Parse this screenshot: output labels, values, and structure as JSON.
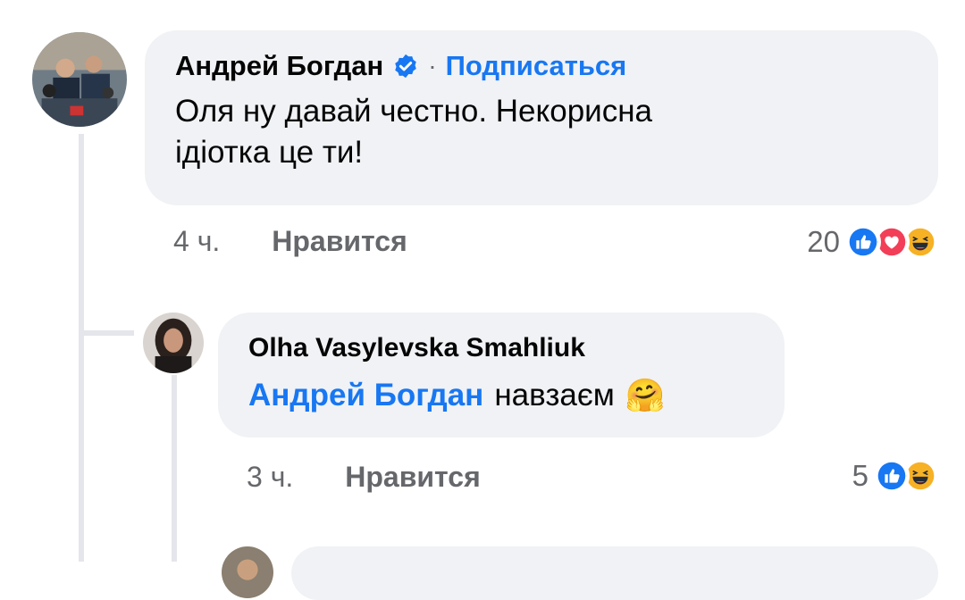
{
  "comment1": {
    "author": "Андрей Богдан",
    "separator": "·",
    "follow_label": "Подписаться",
    "text_line1": "Оля ну давай честно. Некорисна",
    "text_line2": "ідіотка це ти!",
    "time": "4 ч.",
    "like_label": "Нравится",
    "reaction_count": "20",
    "reactions": [
      "like-icon",
      "love-icon",
      "haha-icon"
    ]
  },
  "reply1": {
    "author": "Olha Vasylevska Smahliuk",
    "mention": "Андрей Богдан",
    "text": "навзаєм",
    "emoji": "🤗",
    "time": "3 ч.",
    "like_label": "Нравится",
    "reaction_count": "5",
    "reactions": [
      "like-icon",
      "haha-icon"
    ]
  },
  "colors": {
    "bubble": "#f0f2f5",
    "accent": "#1877f2",
    "meta": "#65676b",
    "thread_line": "#e4e6eb"
  }
}
